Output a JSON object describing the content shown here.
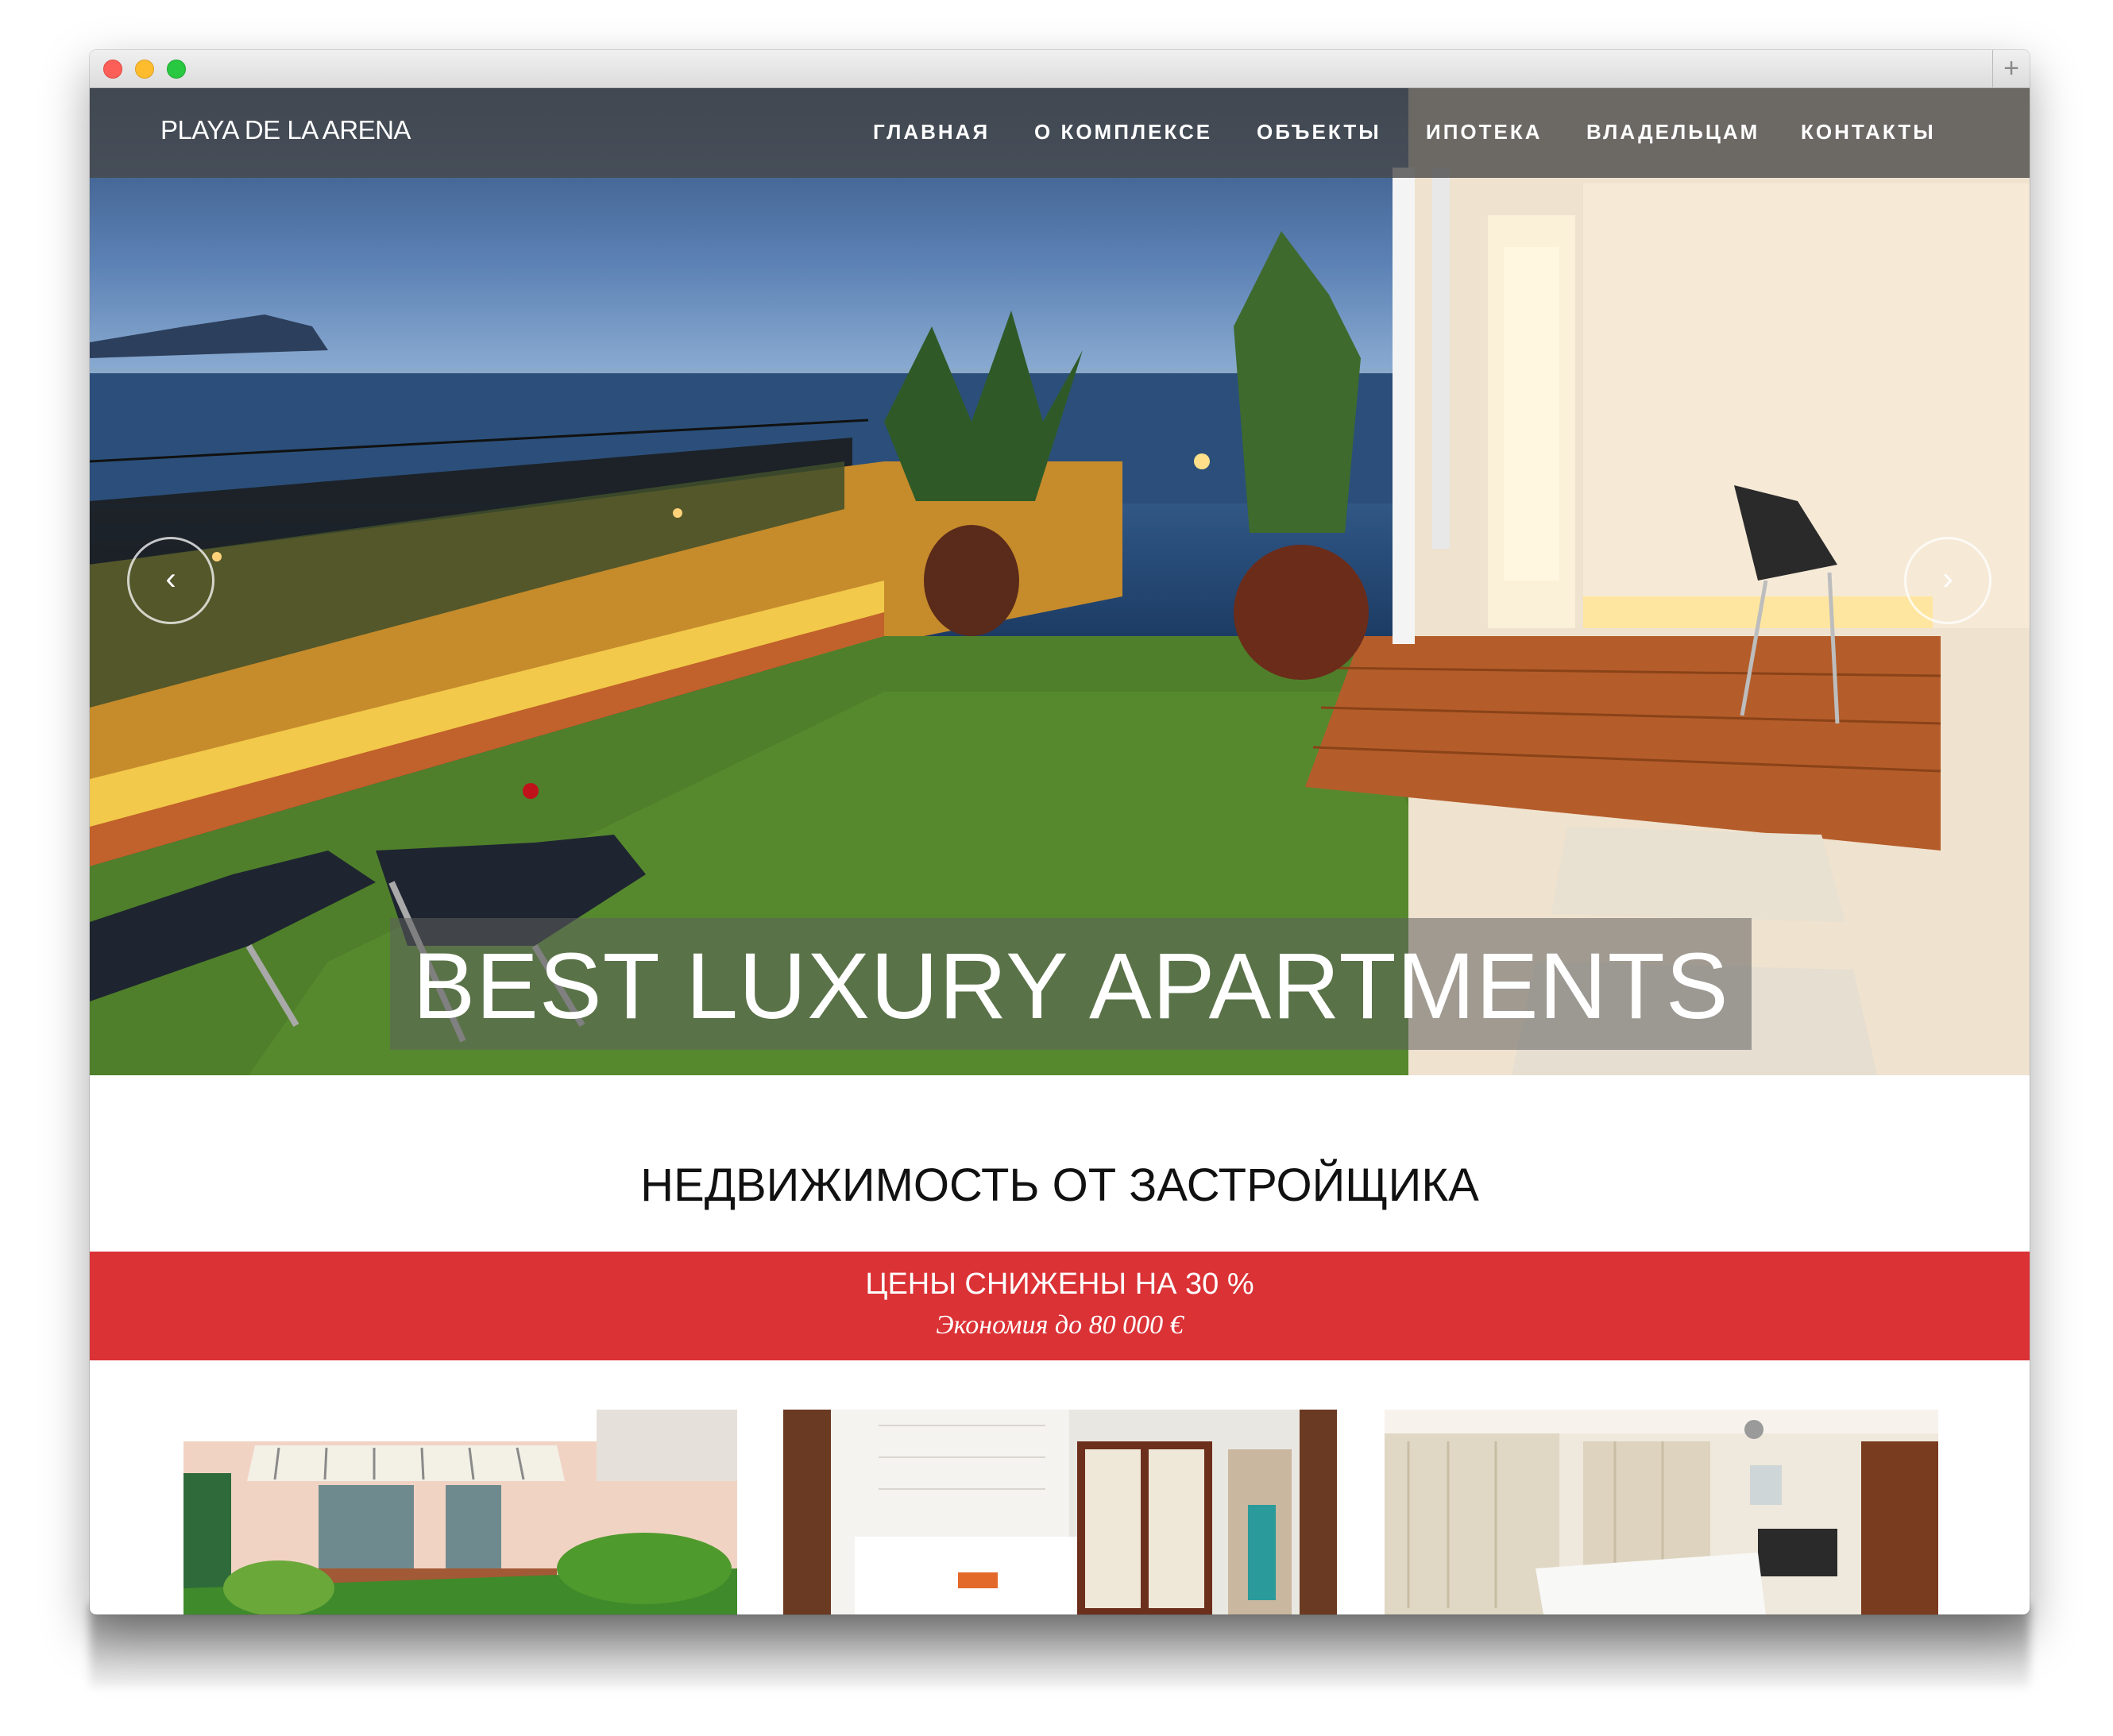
{
  "window": {
    "controls": [
      "close",
      "minimize",
      "zoom"
    ],
    "new_tab_label": "+"
  },
  "site": {
    "brand": "PLAYA DE LA ARENA"
  },
  "nav": {
    "items": [
      "ГЛАВНАЯ",
      "О КОМПЛЕКСЕ",
      "ОБЪЕКТЫ",
      "ИПОТЕКА",
      "ВЛАДЕЛЬЦАМ",
      "КОНТАКТЫ"
    ]
  },
  "hero": {
    "caption": "BEST LUXURY APARTMENTS",
    "prev_icon": "‹",
    "next_icon": "›"
  },
  "headline": "НЕДВИЖИМОСТЬ ОТ ЗАСТРОЙЩИКА",
  "promo": {
    "title": "ЦЕНЫ СНИЖЕНЫ НА 30 %",
    "subtitle": "Экономия до 80 000 €",
    "color": "#db3236"
  },
  "thumbnails": [
    "garden-terrace-photo",
    "bedroom-photo",
    "living-room-photo"
  ]
}
